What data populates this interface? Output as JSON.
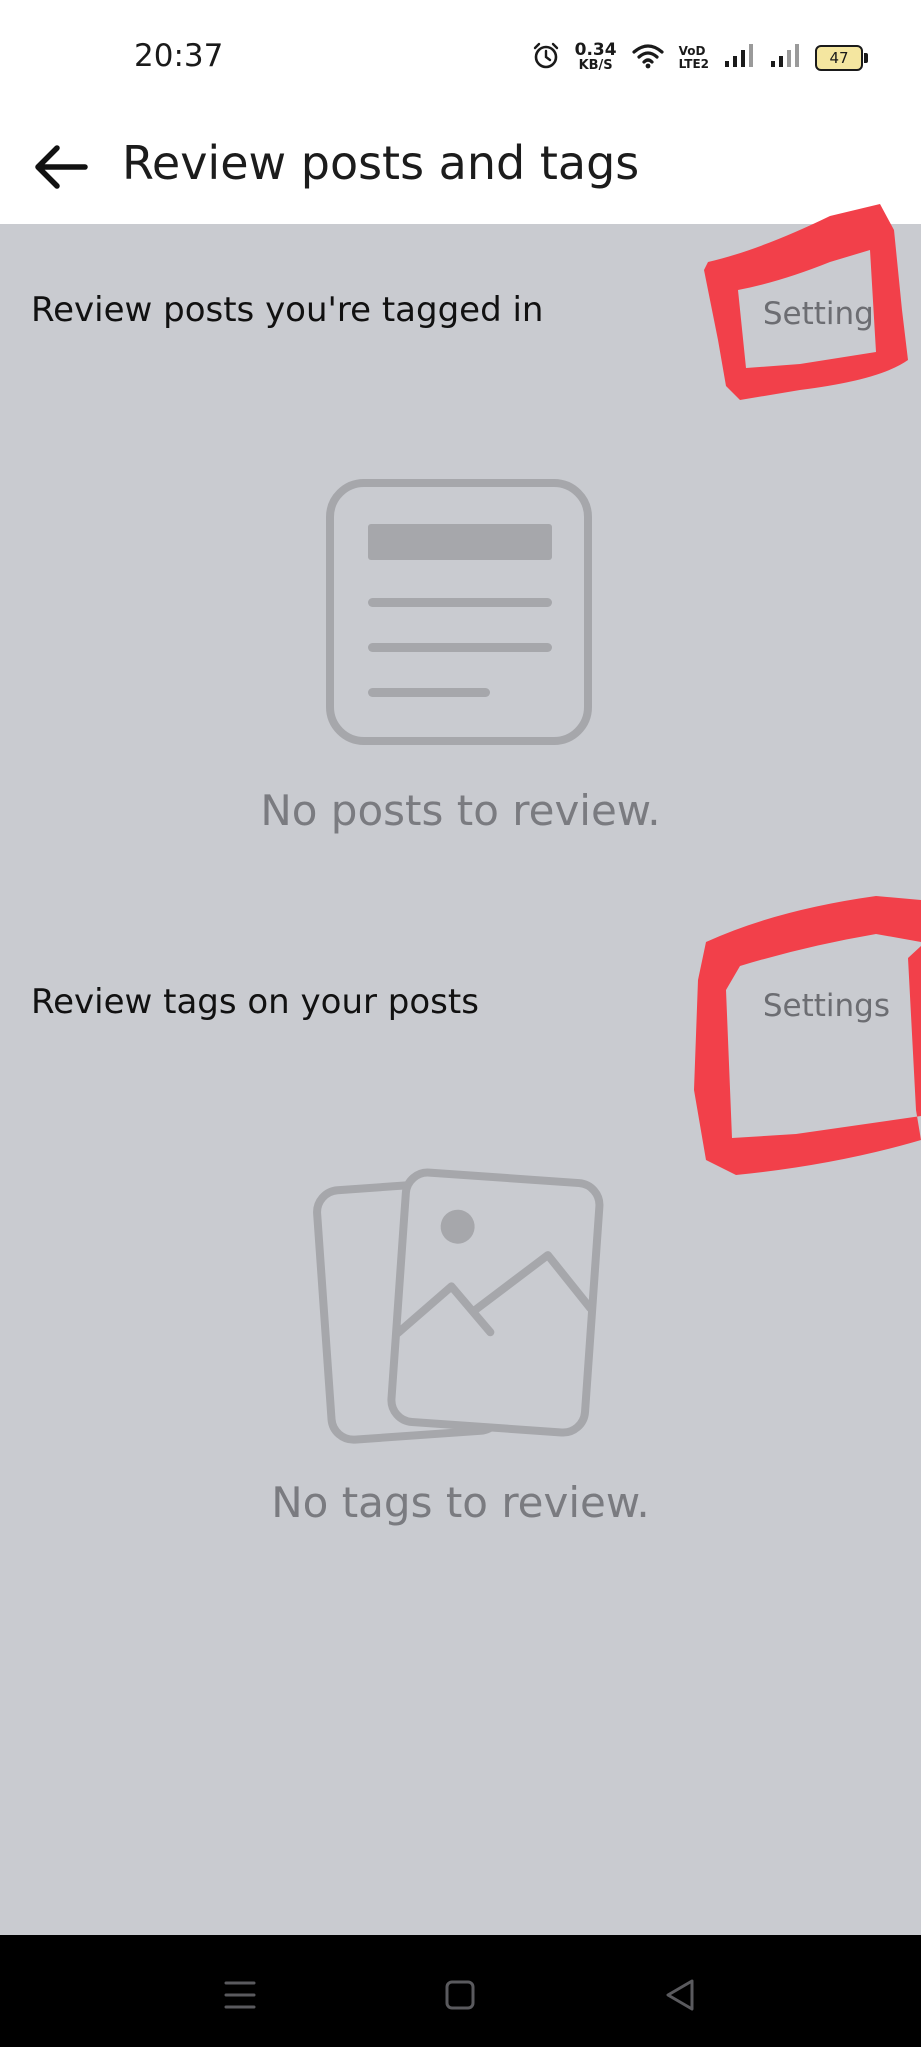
{
  "status_bar": {
    "time": "20:37",
    "net_speed_value": "0.34",
    "net_speed_unit": "KB/S",
    "volte_top": "VoD",
    "volte_bottom": "LTE2",
    "battery": "47",
    "icons": [
      "alarm-icon",
      "wifi-icon",
      "volte-icon",
      "signal-icon",
      "signal-icon",
      "battery-icon"
    ]
  },
  "app_bar": {
    "back_icon": "arrow-left-icon",
    "title": "Review posts and tags"
  },
  "sections": [
    {
      "title": "Review posts you're tagged in",
      "settings_label": "Settings",
      "empty_icon": "document-icon",
      "empty_text": "No posts to review."
    },
    {
      "title": "Review tags on your posts",
      "settings_label": "Settings",
      "empty_icon": "photos-icon",
      "empty_text": "No tags to review."
    }
  ],
  "nav_bar": {
    "icons": [
      "menu-icon",
      "home-square-icon",
      "back-triangle-icon"
    ]
  },
  "colors": {
    "background": "#c9cbd0",
    "annotation": "#f2404a",
    "icon_gray": "#a6a7ab",
    "settings_text": "#6c6d72"
  }
}
